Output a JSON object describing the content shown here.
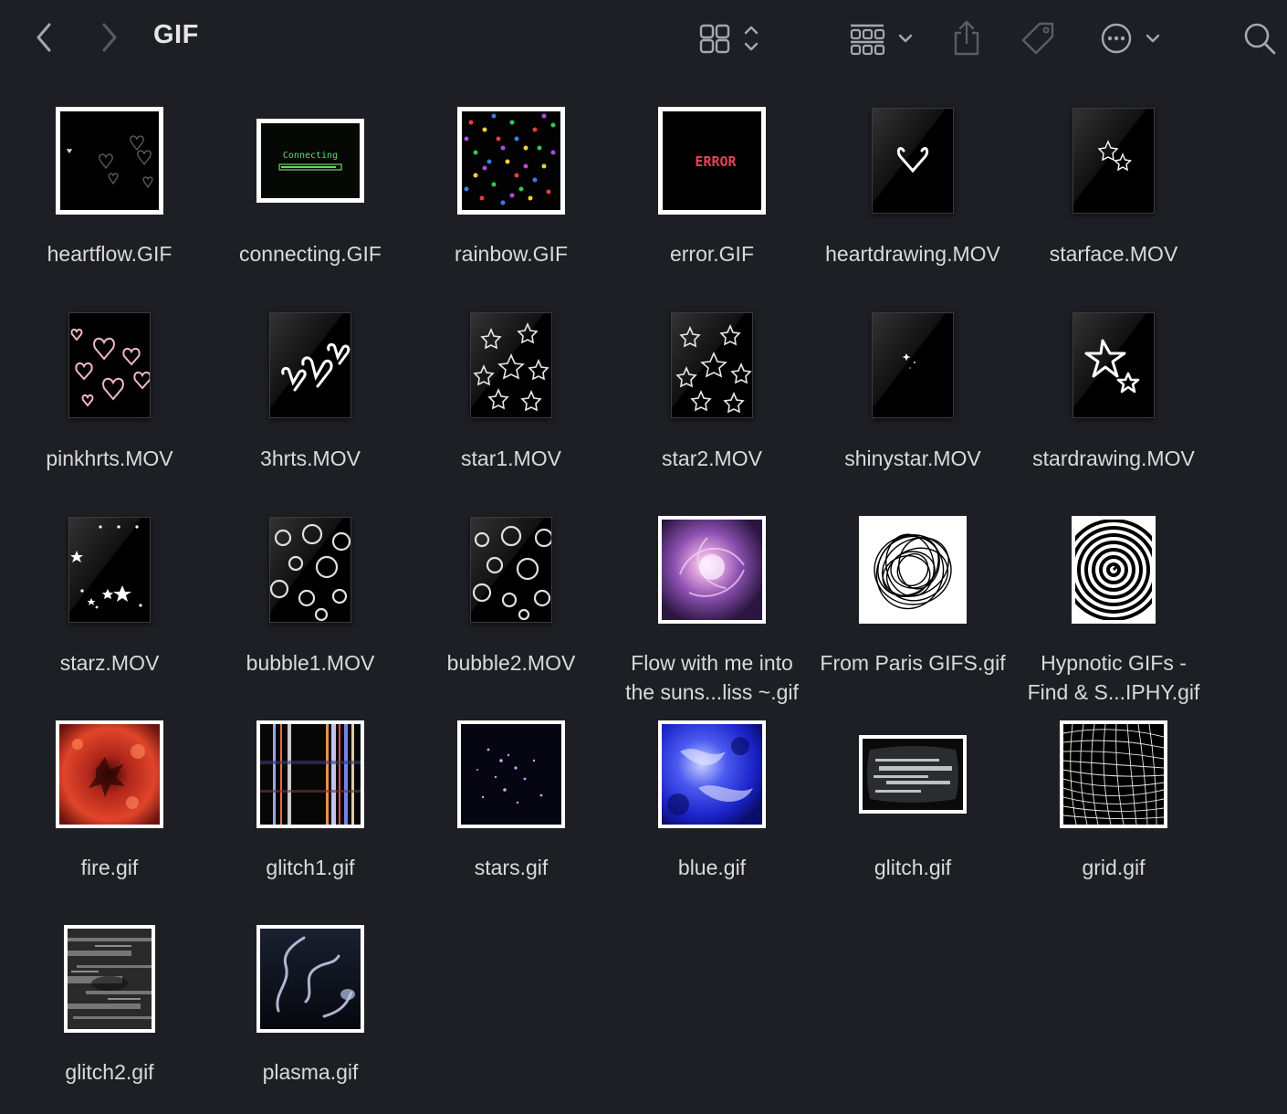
{
  "window": {
    "title": "GIF"
  },
  "toolbar": {
    "back_icon": "chevron-left-icon",
    "forward_icon": "chevron-right-icon",
    "view_icon": "icon-grid-view-icon",
    "group_icon": "group-view-icon",
    "share_icon": "share-icon",
    "tag_icon": "tag-icon",
    "action_icon": "more-actions-icon",
    "search_icon": "search-icon"
  },
  "files": [
    {
      "name": "heartflow.GIF",
      "thumb": "heartflow"
    },
    {
      "name": "connecting.GIF",
      "thumb": "connecting",
      "text": "Connecting"
    },
    {
      "name": "rainbow.GIF",
      "thumb": "rainbow"
    },
    {
      "name": "error.GIF",
      "thumb": "error",
      "text": "ERROR"
    },
    {
      "name": "heartdrawing.MOV",
      "thumb": "heartdrawing"
    },
    {
      "name": "starface.MOV",
      "thumb": "starface"
    },
    {
      "name": "pinkhrts.MOV",
      "thumb": "pinkhrts"
    },
    {
      "name": "3hrts.MOV",
      "thumb": "3hrts"
    },
    {
      "name": "star1.MOV",
      "thumb": "star1"
    },
    {
      "name": "star2.MOV",
      "thumb": "star2"
    },
    {
      "name": "shinystar.MOV",
      "thumb": "shinystar"
    },
    {
      "name": "stardrawing.MOV",
      "thumb": "stardrawing"
    },
    {
      "name": "starz.MOV",
      "thumb": "starz"
    },
    {
      "name": "bubble1.MOV",
      "thumb": "bubble1"
    },
    {
      "name": "bubble2.MOV",
      "thumb": "bubble2"
    },
    {
      "name": "Flow with me into the suns...liss ~.gif",
      "thumb": "flow"
    },
    {
      "name": "From Paris GIFS.gif",
      "thumb": "paris"
    },
    {
      "name": "Hypnotic GIFs - Find & S...IPHY.gif",
      "thumb": "hypnotic"
    },
    {
      "name": "fire.gif",
      "thumb": "fire"
    },
    {
      "name": "glitch1.gif",
      "thumb": "glitch1"
    },
    {
      "name": "stars.gif",
      "thumb": "stars"
    },
    {
      "name": "blue.gif",
      "thumb": "blue"
    },
    {
      "name": "glitch.gif",
      "thumb": "glitch"
    },
    {
      "name": "grid.gif",
      "thumb": "grid"
    },
    {
      "name": "glitch2.gif",
      "thumb": "glitch2"
    },
    {
      "name": "plasma.gif",
      "thumb": "plasma"
    }
  ]
}
